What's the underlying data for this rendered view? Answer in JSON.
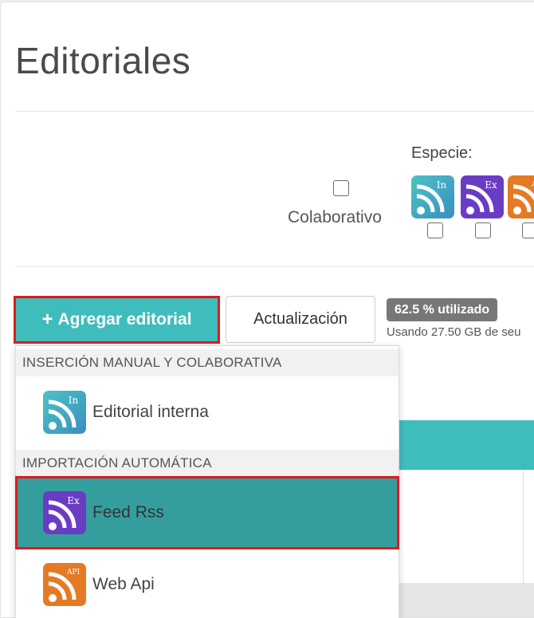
{
  "page": {
    "title": "Editoriales"
  },
  "filters": {
    "colaborativo_label": "Colaborativo",
    "especie_label": "Especie:",
    "species": [
      {
        "name": "interna",
        "badge": "In",
        "color": "#3aa7bf",
        "icon": "rss-feed-icon"
      },
      {
        "name": "externa",
        "badge": "Ex",
        "color": "#6a3cc4",
        "icon": "rss-feed-icon"
      },
      {
        "name": "api",
        "badge": "API",
        "color": "#e57a25",
        "icon": "rss-feed-icon"
      }
    ]
  },
  "toolbar": {
    "add_label": "Agregar editorial",
    "add_icon": "plus-icon",
    "update_label": "Actualización",
    "usage_badge": "62.5 % utilizado",
    "usage_text": "Usando 27.50 GB de seu"
  },
  "dropdown": {
    "sections": [
      {
        "header": "INSERCIÓN MANUAL Y COLABORATIVA",
        "items": [
          {
            "label": "Editorial interna",
            "badge": "In"
          }
        ]
      },
      {
        "header": "IMPORTACIÓN AUTOMÁTICA",
        "items": [
          {
            "label": "Feed Rss",
            "badge": "Ex",
            "active": true
          },
          {
            "label": "Web Api",
            "badge": "API"
          }
        ]
      }
    ]
  },
  "colors": {
    "accent": "#3fbdbd",
    "active_item": "#349e9e",
    "highlight_border": "#e01a1a",
    "badge_gray": "#777777"
  }
}
